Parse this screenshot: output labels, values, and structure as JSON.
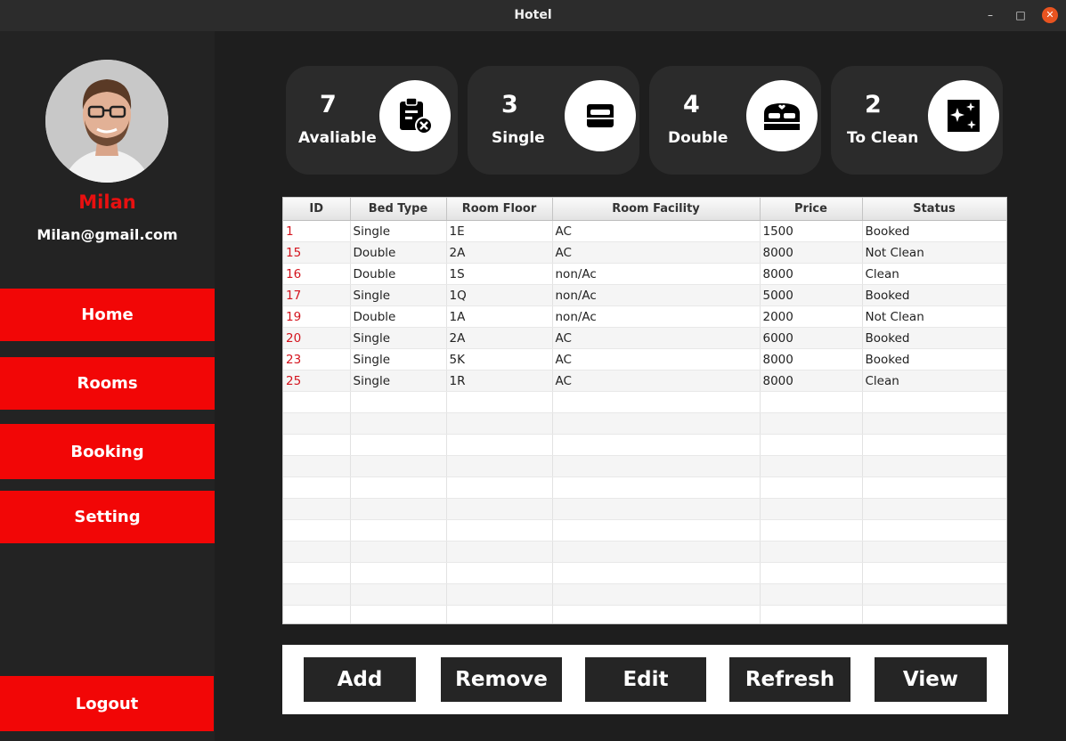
{
  "window": {
    "title": "Hotel",
    "controls": {
      "minimize": "–",
      "maximize": "□",
      "close": "✕"
    }
  },
  "user": {
    "name": "Milan",
    "email": "Milan@gmail.com"
  },
  "nav": {
    "home": "Home",
    "rooms": "Rooms",
    "booking": "Booking",
    "setting": "Setting",
    "logout": "Logout"
  },
  "stats": [
    {
      "value": "7",
      "label": "Avaliable",
      "icon": "clipboard-x-icon"
    },
    {
      "value": "3",
      "label": "Single",
      "icon": "single-bed-icon"
    },
    {
      "value": "4",
      "label": "Double",
      "icon": "double-bed-icon"
    },
    {
      "value": "2",
      "label": "To Clean",
      "icon": "sparkles-icon"
    }
  ],
  "table": {
    "columns": [
      "ID",
      "Bed Type",
      "Room Floor",
      "Room Facility",
      "Price",
      "Status"
    ],
    "rows": [
      [
        "1",
        "Single",
        "1E",
        "AC",
        "1500",
        "Booked"
      ],
      [
        "15",
        "Double",
        "2A",
        "AC",
        "8000",
        "Not Clean"
      ],
      [
        "16",
        "Double",
        "1S",
        "non/Ac",
        "8000",
        "Clean"
      ],
      [
        "17",
        "Single",
        "1Q",
        "non/Ac",
        "5000",
        "Booked"
      ],
      [
        "19",
        "Double",
        "1A",
        "non/Ac",
        "2000",
        "Not Clean"
      ],
      [
        "20",
        "Single",
        "2A",
        "AC",
        "6000",
        "Booked"
      ],
      [
        "23",
        "Single",
        "5K",
        "AC",
        "8000",
        "Booked"
      ],
      [
        "25",
        "Single",
        "1R",
        "AC",
        "8000",
        "Clean"
      ]
    ]
  },
  "actions": {
    "add": "Add",
    "remove": "Remove",
    "edit": "Edit",
    "refresh": "Refresh",
    "view": "View"
  },
  "colors": {
    "accent": "#f20606",
    "sidebar": "#232323",
    "background": "#1e1e1e",
    "card": "#2b2b2b",
    "id_text": "#d4141e"
  }
}
